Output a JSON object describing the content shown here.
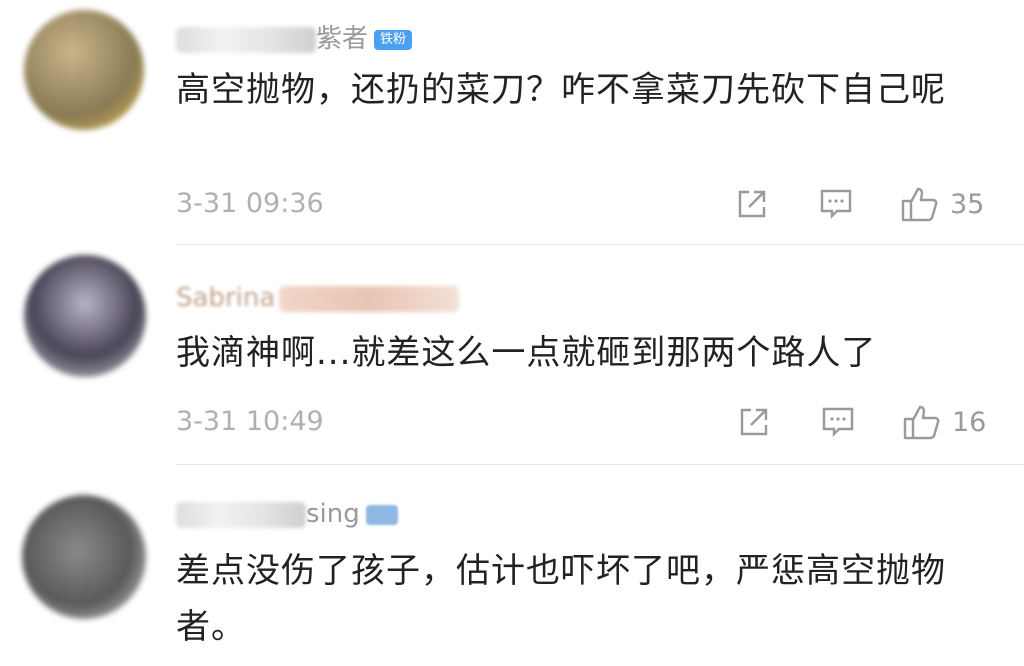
{
  "comments": [
    {
      "username_suffix": "紫者",
      "badge": "铁粉",
      "text": "高空抛物，还扔的菜刀？咋不拿菜刀先砍下自己呢",
      "time": "3-31 09:36",
      "likes": "35"
    },
    {
      "username_suffix": "Sabrina",
      "badge": "",
      "text": "我滴神啊...就差这么一点就砸到那两个路人了",
      "time": "3-31 10:49",
      "likes": "16"
    },
    {
      "username_suffix": "sing",
      "badge": "",
      "text": "差点没伤了孩子，估计也吓坏了吧，严惩高空抛物者。",
      "time": "",
      "likes": ""
    }
  ],
  "icons": {
    "share": "share-icon",
    "reply": "comment-icon",
    "like": "thumbs-up-icon"
  },
  "colors": {
    "badge": "#4aa0f2",
    "meta_text": "#b0b0b0",
    "body_text": "#222222"
  }
}
